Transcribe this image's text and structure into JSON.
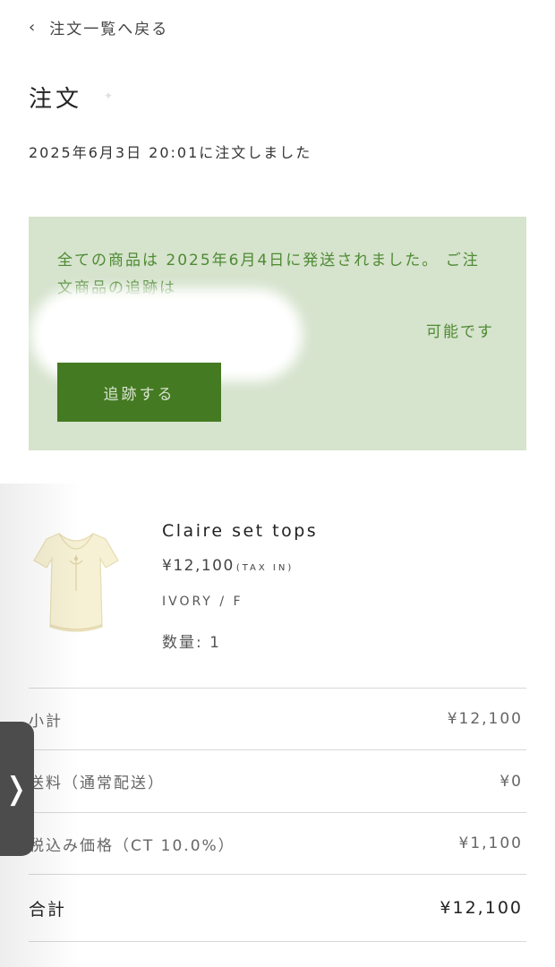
{
  "header": {
    "back_label": "注文一覧へ戻る",
    "title": "注文",
    "order_date": "2025年6月3日 20:01に注文しました"
  },
  "shipping": {
    "message": "全ての商品は 2025年6月4日に発送されました。 ご注文商品の追跡は",
    "possible": "可能です",
    "track_button": "追跡する"
  },
  "product": {
    "name": "Claire set tops",
    "price": "¥12,100",
    "tax_note": "(TAX IN)",
    "variant": "IVORY / F",
    "quantity": "数量: 1"
  },
  "summary": {
    "subtotal_label": "小計",
    "subtotal_value": "¥12,100",
    "shipping_label": "送料（通常配送）",
    "shipping_value": "¥0",
    "tax_label": "税込み価格（CT 10.0%）",
    "tax_value": "¥1,100",
    "total_label": "合計",
    "total_value": "¥12,100"
  },
  "colors": {
    "ship_box_bg": "#d6e3cd",
    "ship_text": "#4e8b33",
    "track_button_bg": "#447a22"
  }
}
